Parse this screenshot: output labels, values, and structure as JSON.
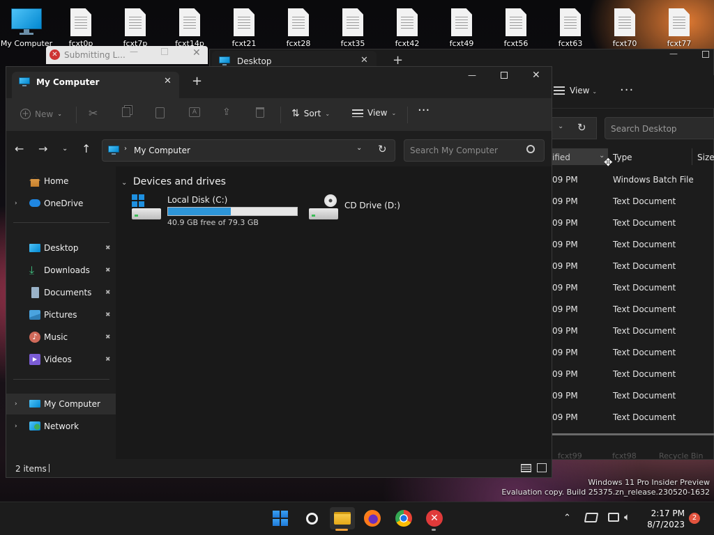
{
  "desktop": {
    "icons": [
      {
        "label": "My Computer"
      },
      {
        "label": "fcxt0p"
      },
      {
        "label": "fcxt7p"
      },
      {
        "label": "fcxt14p"
      },
      {
        "label": "fcxt21"
      },
      {
        "label": "fcxt28"
      },
      {
        "label": "fcxt35"
      },
      {
        "label": "fcxt42"
      },
      {
        "label": "fcxt49"
      },
      {
        "label": "fcxt56"
      },
      {
        "label": "fcxt63"
      },
      {
        "label": "fcxt70"
      },
      {
        "label": "fcxt77"
      }
    ]
  },
  "bg_dialog": {
    "title": "Submitting L..."
  },
  "bg_window": {
    "tab_title": "Desktop",
    "view_label": "View",
    "search_placeholder": "Search Desktop",
    "col_modified": "ified",
    "col_type": "Type",
    "col_size": "Size",
    "rows": [
      {
        "time": "09 PM",
        "type": "Windows Batch File"
      },
      {
        "time": "09 PM",
        "type": "Text Document"
      },
      {
        "time": "09 PM",
        "type": "Text Document"
      },
      {
        "time": "09 PM",
        "type": "Text Document"
      },
      {
        "time": "09 PM",
        "type": "Text Document"
      },
      {
        "time": "09 PM",
        "type": "Text Document"
      },
      {
        "time": "09 PM",
        "type": "Text Document"
      },
      {
        "time": "09 PM",
        "type": "Text Document"
      },
      {
        "time": "09 PM",
        "type": "Text Document"
      },
      {
        "time": "09 PM",
        "type": "Text Document"
      },
      {
        "time": "09 PM",
        "type": "Text Document"
      },
      {
        "time": "09 PM",
        "type": "Text Document"
      }
    ],
    "footer": {
      "a": "fcxt99",
      "b": "fcxt98",
      "c": "Recycle Bin"
    }
  },
  "window": {
    "tab_title": "My Computer",
    "toolbar": {
      "new_label": "New",
      "sort_label": "Sort",
      "view_label": "View"
    },
    "address": {
      "crumb": "My Computer"
    },
    "search": {
      "placeholder": "Search My Computer"
    },
    "sidebar": {
      "items": [
        {
          "label": "Home"
        },
        {
          "label": "OneDrive"
        },
        {
          "label": "Desktop"
        },
        {
          "label": "Downloads"
        },
        {
          "label": "Documents"
        },
        {
          "label": "Pictures"
        },
        {
          "label": "Music"
        },
        {
          "label": "Videos"
        },
        {
          "label": "My Computer"
        },
        {
          "label": "Network"
        }
      ]
    },
    "content": {
      "group_title": "Devices and drives",
      "drives": [
        {
          "name": "Local Disk (C:)",
          "free_text": "40.9 GB free of 79.3 GB",
          "used_fraction": 0.484
        },
        {
          "name": "CD Drive (D:)"
        }
      ]
    },
    "status": {
      "items": "2 items"
    }
  },
  "watermark": {
    "line1": "Windows 11 Pro Insider Preview",
    "line2": "Evaluation copy. Build 25375.zn_release.230520-1632"
  },
  "taskbar": {
    "time": "2:17 PM",
    "date": "8/7/2023",
    "notification_count": "2"
  },
  "colors": {
    "accent": "#2d95d8",
    "error_red": "#e03a3a"
  }
}
